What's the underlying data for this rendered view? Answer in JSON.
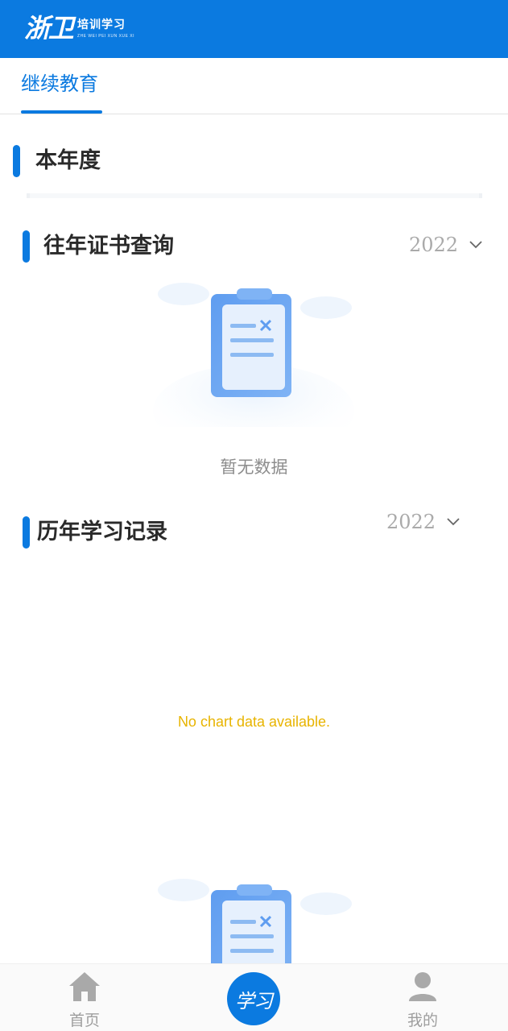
{
  "header": {
    "logo_brush": "浙卫",
    "logo_cn": "培训学习",
    "logo_pinyin": "ZHE WEI PEI XUN XUE XI",
    "bg_color": "#0b7ae0"
  },
  "tabs": [
    {
      "label": "继续教育",
      "active": true
    }
  ],
  "sections": {
    "current_year": {
      "title": "本年度"
    },
    "past_certificates": {
      "title": "往年证书查询",
      "year": "2022",
      "empty_text": "暂无数据",
      "empty_icon": "clipboard-empty-icon"
    },
    "history_records": {
      "title": "历年学习记录",
      "year": "2022",
      "no_chart_text": "No chart data available.",
      "empty_icon": "clipboard-empty-icon"
    }
  },
  "bottom_nav": {
    "items": [
      {
        "label": "首页",
        "icon": "home-icon"
      },
      {
        "label": "学习",
        "icon": "study-icon",
        "active": true
      },
      {
        "label": "我的",
        "icon": "user-icon"
      }
    ]
  },
  "colors": {
    "accent": "#0b7ae0",
    "no_data_text": "#e8b400",
    "muted": "#aaaaaa"
  }
}
